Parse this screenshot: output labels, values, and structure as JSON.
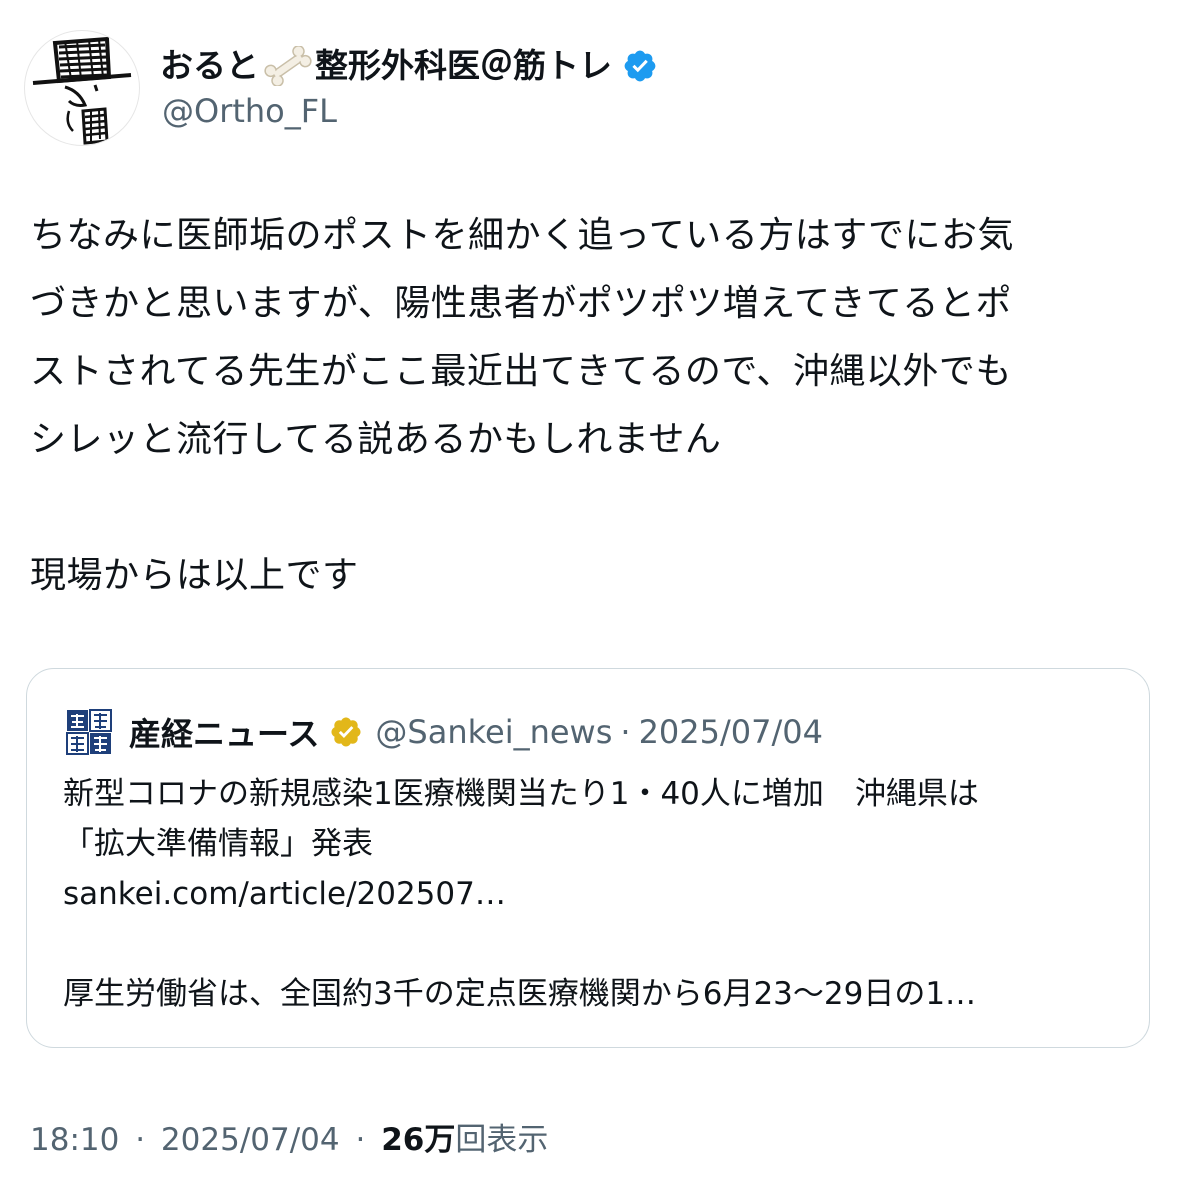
{
  "author": {
    "display_name": "おると",
    "display_name_suffix": "整形外科医＠筋トレ",
    "handle": "@Ortho_FL",
    "verified": true,
    "avatar_icon": "hand-drawn-top-hat-character-avatar",
    "name_emoji": "bone-icon"
  },
  "post": {
    "lines": [
      "ちなみに医師垢のポストを細かく追っている方はすでにお気",
      "づきかと思いますが、陽性患者がポツポツ増えてきてるとポ",
      "ストされてる先生がここ最近出てきてるので、沖縄以外でも",
      "シレッと流行してる説あるかもしれません",
      "",
      "現場からは以上です"
    ]
  },
  "quote": {
    "display_name": "産経ニュース",
    "handle": "@Sankei_news",
    "separator": "·",
    "date": "2025/07/04",
    "logo_icon": "sankei-newspaper-logo",
    "verified_badge": "gold-verified-badge",
    "lines": [
      "新型コロナの新規感染1医療機関当たり1・40人に増加　沖縄県は",
      "「拡大準備情報」発表",
      "sankei.com/article/202507…",
      "",
      "厚生労働省は、全国約3千の定点医療機関から6月23〜29日の1…"
    ]
  },
  "footer": {
    "time": "18:10",
    "sep1": "·",
    "date": "2025/07/04",
    "sep2": "·",
    "views_count": "26万",
    "views_label": "回表示"
  },
  "colors": {
    "text": "#0f1419",
    "secondary": "#536471",
    "border": "#cfd9de",
    "verified_blue": "#1d9bf0",
    "verified_gold": "#e2b719"
  }
}
